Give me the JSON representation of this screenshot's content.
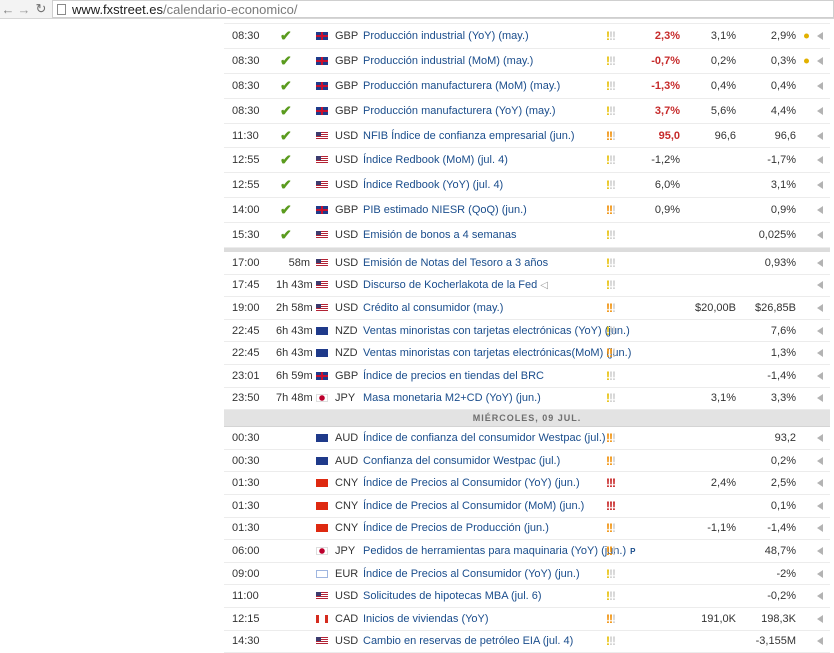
{
  "browser": {
    "back_icon": "arrow-left-icon",
    "forward_icon": "arrow-right-icon",
    "reload_icon": "reload-icon",
    "url_host": "www.fxstreet.es",
    "url_path": "/calendario-economico/"
  },
  "colors": {
    "event_link": "#1a4d8c",
    "negative": "#c62b2b",
    "check": "#5a9b1e",
    "importance_low": "#e6be00",
    "importance_medium": "#f08c00",
    "importance_high": "#c41a1a"
  },
  "rows_top": [
    {
      "time": "08:30",
      "status": "done",
      "currency": "GBP",
      "event": "Producción industrial (YoY) (may.)",
      "importance": "low",
      "actual": "2,3%",
      "actual_color": "pos",
      "forecast": "3,1%",
      "previous": "2,9%",
      "dot": true
    },
    {
      "time": "08:30",
      "status": "done",
      "currency": "GBP",
      "event": "Producción industrial (MoM) (may.)",
      "importance": "low",
      "actual": "-0,7%",
      "actual_color": "neg",
      "forecast": "0,2%",
      "previous": "0,3%",
      "dot": true
    },
    {
      "time": "08:30",
      "status": "done",
      "currency": "GBP",
      "event": "Producción manufacturera (MoM) (may.)",
      "importance": "low",
      "actual": "-1,3%",
      "actual_color": "neg",
      "forecast": "0,4%",
      "previous": "0,4%",
      "dot": false
    },
    {
      "time": "08:30",
      "status": "done",
      "currency": "GBP",
      "event": "Producción manufacturera (YoY) (may.)",
      "importance": "low",
      "actual": "3,7%",
      "actual_color": "pos",
      "forecast": "5,6%",
      "previous": "4,4%",
      "dot": false
    },
    {
      "time": "11:30",
      "status": "done",
      "currency": "USD",
      "event": "NFIB Índice de confianza empresarial (jun.)",
      "importance": "medium",
      "actual": "95,0",
      "actual_color": "pos",
      "forecast": "96,6",
      "previous": "96,6",
      "dot": false
    },
    {
      "time": "12:55",
      "status": "done",
      "currency": "USD",
      "event": "Índice Redbook (MoM) (jul. 4)",
      "importance": "low",
      "actual": "-1,2%",
      "actual_color": "plain",
      "forecast": "",
      "previous": "-1,7%",
      "dot": false
    },
    {
      "time": "12:55",
      "status": "done",
      "currency": "USD",
      "event": "Índice Redbook (YoY) (jul. 4)",
      "importance": "low",
      "actual": "6,0%",
      "actual_color": "plain",
      "forecast": "",
      "previous": "3,1%",
      "dot": false
    },
    {
      "time": "14:00",
      "status": "done",
      "currency": "GBP",
      "event": "PIB estimado NIESR (QoQ) (jun.)",
      "importance": "medium",
      "actual": "0,9%",
      "actual_color": "plain",
      "forecast": "",
      "previous": "0,9%",
      "dot": false
    },
    {
      "time": "15:30",
      "status": "done",
      "currency": "USD",
      "event": "Emisión de bonos a 4 semanas",
      "importance": "low",
      "actual": "",
      "actual_color": "plain",
      "forecast": "",
      "previous": "0,025%",
      "dot": false
    }
  ],
  "rows_upcoming": [
    {
      "time": "17:00",
      "remaining": "58m",
      "currency": "USD",
      "event": "Emisión de Notas del Tesoro a 3 años",
      "importance": "low",
      "actual": "",
      "forecast": "",
      "previous": "0,93%",
      "speaker": false
    },
    {
      "time": "17:45",
      "remaining": "1h 43m",
      "currency": "USD",
      "event": "Discurso de Kocherlakota de la Fed",
      "importance": "low",
      "actual": "",
      "forecast": "",
      "previous": "",
      "speaker": true
    },
    {
      "time": "19:00",
      "remaining": "2h 58m",
      "currency": "USD",
      "event": "Crédito al consumidor (may.)",
      "importance": "medium",
      "actual": "",
      "forecast": "$20,00B",
      "previous": "$26,85B",
      "speaker": false
    },
    {
      "time": "22:45",
      "remaining": "6h 43m",
      "currency": "NZD",
      "event": "Ventas minoristas con tarjetas electrónicas (YoY) (jun.)",
      "importance": "low",
      "actual": "",
      "forecast": "",
      "previous": "7,6%",
      "speaker": false
    },
    {
      "time": "22:45",
      "remaining": "6h 43m",
      "currency": "NZD",
      "event": "Ventas minoristas con tarjetas electrónicas(MoM) (jun.)",
      "importance": "medium",
      "actual": "",
      "forecast": "",
      "previous": "1,3%",
      "speaker": false
    },
    {
      "time": "23:01",
      "remaining": "6h 59m",
      "currency": "GBP",
      "event": "Índice de precios en tiendas del BRC",
      "importance": "low",
      "actual": "",
      "forecast": "",
      "previous": "-1,4%",
      "speaker": false
    },
    {
      "time": "23:50",
      "remaining": "7h 48m",
      "currency": "JPY",
      "event": "Masa monetaria M2+CD (YoY) (jun.)",
      "importance": "low",
      "actual": "",
      "forecast": "3,1%",
      "previous": "3,3%",
      "speaker": false
    }
  ],
  "day_header": "MIÉRCOLES, 09 JUL.",
  "rows_next_day": [
    {
      "time": "00:30",
      "currency": "AUD",
      "event": "Índice de confianza del consumidor Westpac (jul.)",
      "importance": "medium",
      "forecast": "",
      "previous": "93,2",
      "prelim": false
    },
    {
      "time": "00:30",
      "currency": "AUD",
      "event": "Confianza del consumidor Westpac (jul.)",
      "importance": "medium",
      "forecast": "",
      "previous": "0,2%",
      "prelim": false
    },
    {
      "time": "01:30",
      "currency": "CNY",
      "event": "Índice de Precios al Consumidor (YoY) (jun.)",
      "importance": "high",
      "forecast": "2,4%",
      "previous": "2,5%",
      "prelim": false
    },
    {
      "time": "01:30",
      "currency": "CNY",
      "event": "Índice de Precios al Consumidor (MoM) (jun.)",
      "importance": "high",
      "forecast": "",
      "previous": "0,1%",
      "prelim": false
    },
    {
      "time": "01:30",
      "currency": "CNY",
      "event": "Índice de Precios de Producción (jun.)",
      "importance": "medium",
      "forecast": "-1,1%",
      "previous": "-1,4%",
      "prelim": false
    },
    {
      "time": "06:00",
      "currency": "JPY",
      "event": "Pedidos de herramientas para maquinaria (YoY) (jun.)",
      "importance": "medium",
      "forecast": "",
      "previous": "48,7%",
      "prelim": true,
      "prelim_label": "P"
    },
    {
      "time": "09:00",
      "currency": "EUR",
      "event": "Índice de Precios al Consumidor (YoY) (jun.)",
      "importance": "low",
      "forecast": "",
      "previous": "-2%",
      "prelim": false
    },
    {
      "time": "11:00",
      "currency": "USD",
      "event": "Solicitudes de hipotecas MBA (jul. 6)",
      "importance": "low",
      "forecast": "",
      "previous": "-0,2%",
      "prelim": false
    },
    {
      "time": "12:15",
      "currency": "CAD",
      "event": "Inicios de viviendas (YoY)",
      "importance": "medium",
      "forecast": "191,0K",
      "previous": "198,3K",
      "prelim": false
    },
    {
      "time": "14:30",
      "currency": "USD",
      "event": "Cambio en reservas de petróleo EIA (jul. 4)",
      "importance": "low",
      "forecast": "",
      "previous": "-3,155M",
      "prelim": false
    }
  ]
}
